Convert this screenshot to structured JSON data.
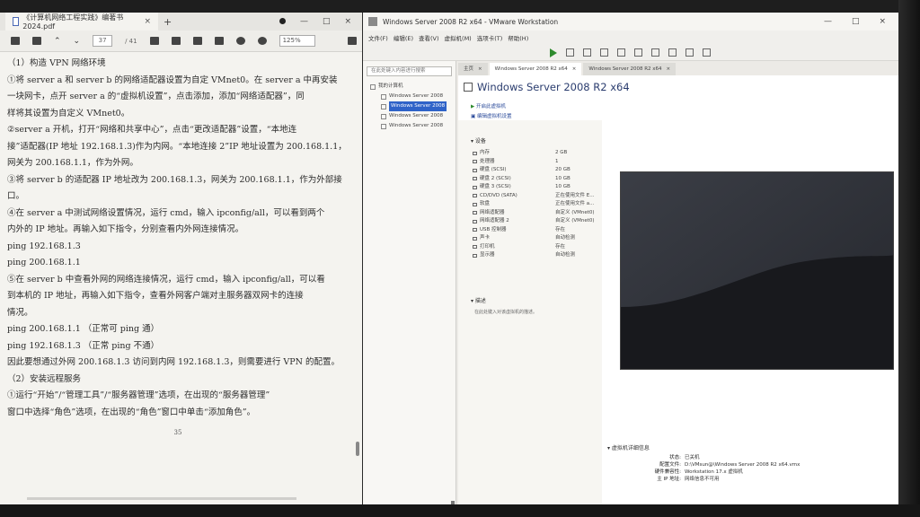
{
  "pdf": {
    "tab_title": "《计算机网络工程实践》编著书 2024.pdf",
    "page_current": "37",
    "page_total": "/ 41",
    "zoom": "125%",
    "page_number": "35",
    "paragraphs": [
      "（1）构造 VPN 网络环境",
      "①将 server a 和 server b 的网络适配器设置为自定 VMnet0。在 server a 中再安装",
      "一块网卡，点开 server a 的“虚拟机设置”，点击添加，添加“网络适配器”，同",
      "样将其设置为自定义 VMnet0。",
      "②server a 开机，打开“网络和共享中心”，点击“更改适配器”设置，“本地连",
      "接”适配器(IP 地址 192.168.1.3)作为内网。“本地连接 2”IP 地址设置为 200.168.1.1，",
      "网关为 200.168.1.1，作为外网。",
      "③将 server b 的适配器 IP 地址改为 200.168.1.3，网关为 200.168.1.1，作为外部接",
      "口。",
      "④在 server a 中测试网络设置情况，运行 cmd，输入 ipconfig/all，可以看到两个",
      "内外的 IP 地址。再输入如下指令，分别查看内外网连接情况。",
      "ping 192.168.1.3",
      "ping 200.168.1.1",
      "⑤在 server b 中查看外网的网络连接情况，运行 cmd，输入 ipconfig/all，可以看",
      "到本机的 IP 地址，再输入如下指令，查看外网客户端对主服务器双网卡的连接",
      "情况。",
      "ping 200.168.1.1      （正常可 ping 通）",
      "ping 192.168.1.3      （正常 ping 不通）",
      "因此要想通过外网 200.168.1.3 访问到内网 192.168.1.3，则需要进行 VPN 的配置。",
      "（2）安装远程服务",
      "①运行“开始”/“管理工具”/“服务器管理”选项，在出现的“服务器管理”",
      "窗口中选择“角色”选项，在出现的“角色”窗口中单击“添加角色”。"
    ]
  },
  "vmware": {
    "title": "Windows Server 2008 R2 x64 - VMware Workstation",
    "menu": [
      "文件(F)",
      "编辑(E)",
      "查看(V)",
      "虚拟机(M)",
      "选项卡(T)",
      "帮助(H)"
    ],
    "search_placeholder": "在此处键入内容进行搜索",
    "library_root": "我的计算机",
    "library_items": [
      "Windows Server 2008",
      "Windows Server 2008",
      "Windows Server 2008",
      "Windows Server 2008"
    ],
    "tabs": [
      "主页",
      "Windows Server 2008 R2 x64",
      "Windows Server 2008 R2 x64"
    ],
    "vm_name": "Windows Server 2008 R2 x64",
    "action_power_on": "开启此虚拟机",
    "action_edit": "编辑虚拟机设置",
    "devices_head": "设备",
    "devices": [
      {
        "name": "内存",
        "value": "2 GB"
      },
      {
        "name": "处理器",
        "value": "1"
      },
      {
        "name": "硬盘 (SCSI)",
        "value": "20 GB"
      },
      {
        "name": "硬盘 2 (SCSI)",
        "value": "10 GB"
      },
      {
        "name": "硬盘 3 (SCSI)",
        "value": "10 GB"
      },
      {
        "name": "CD/DVD (SATA)",
        "value": "正在使用文件 E..."
      },
      {
        "name": "软盘",
        "value": "正在使用文件 a..."
      },
      {
        "name": "网络适配器",
        "value": "自定义 (VMnet0)"
      },
      {
        "name": "网络适配器 2",
        "value": "自定义 (VMnet0)"
      },
      {
        "name": "USB 控制器",
        "value": "存在"
      },
      {
        "name": "声卡",
        "value": "自动检测"
      },
      {
        "name": "打印机",
        "value": "存在"
      },
      {
        "name": "显示器",
        "value": "自动检测"
      }
    ],
    "desc_head": "描述",
    "desc_hint": "在此处键入对该虚拟机的描述。",
    "details_head": "虚拟机详细信息",
    "details": [
      {
        "k": "状态:",
        "v": "已关机"
      },
      {
        "k": "配置文件:",
        "v": "D:\\VMsun@\\Windows Server 2008 R2 x64.vmx"
      },
      {
        "k": "硬件兼容性:",
        "v": "Workstation 17.x 虚拟机"
      },
      {
        "k": "主 IP 地址:",
        "v": "网络信息不可用"
      }
    ]
  }
}
